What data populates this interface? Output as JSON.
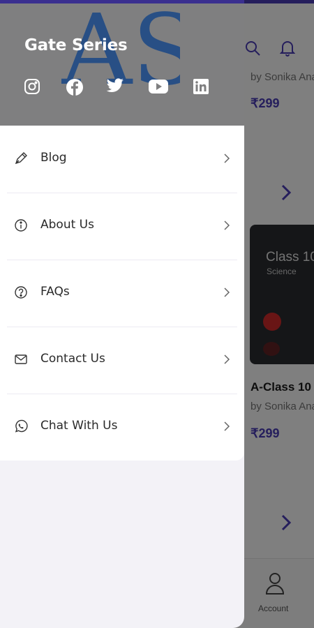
{
  "colors": {
    "accent": "#4a3cb8",
    "header_bg": "#7f7f80",
    "drawer_bg": "#f3f2f7",
    "menu_bg": "#ffffff"
  },
  "drawer": {
    "header": {
      "title": "Gate Series",
      "logo": "AS",
      "social": [
        {
          "name": "instagram-icon"
        },
        {
          "name": "facebook-icon"
        },
        {
          "name": "twitter-icon"
        },
        {
          "name": "youtube-icon"
        },
        {
          "name": "linkedin-icon"
        }
      ]
    },
    "menu": [
      {
        "label": "Blog",
        "icon": "pen-icon"
      },
      {
        "label": "About Us",
        "icon": "info-icon"
      },
      {
        "label": "FAQs",
        "icon": "question-icon"
      },
      {
        "label": "Contact Us",
        "icon": "mail-icon"
      },
      {
        "label": "Chat With Us",
        "icon": "whatsapp-icon"
      }
    ]
  },
  "background": {
    "course1": {
      "author": "by Sonika Ana",
      "price": "₹299"
    },
    "card": {
      "title": "Class 10",
      "subtitle": "Science"
    },
    "course2": {
      "title": "A-Class 10",
      "author": "by Sonika Ana",
      "price": "₹299"
    },
    "bottom_nav": {
      "account_label": "Account"
    }
  }
}
